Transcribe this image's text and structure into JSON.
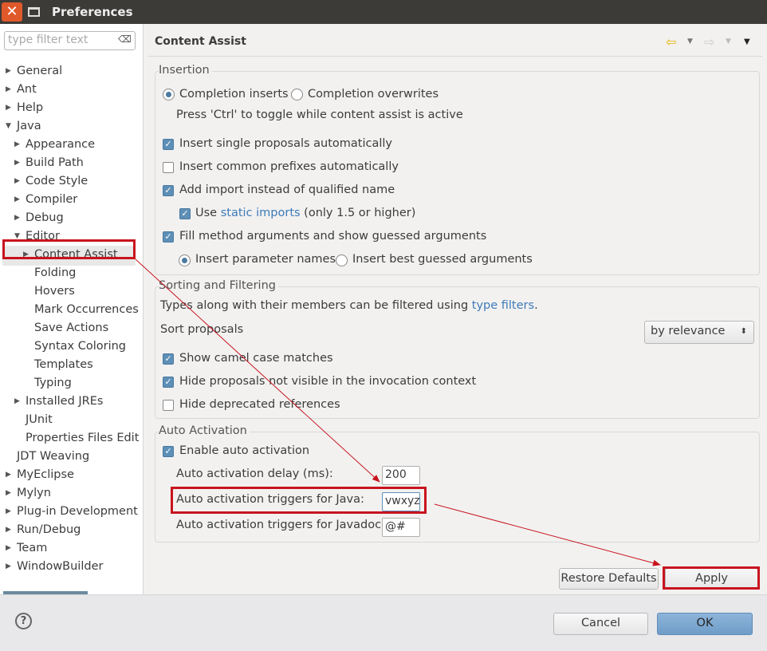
{
  "window": {
    "title": "Preferences",
    "close_icon": "close-icon",
    "maximize_icon": "maximize-icon"
  },
  "filter": {
    "placeholder": "type filter text"
  },
  "tree": [
    {
      "label": "General",
      "level": 0,
      "arrow": "right"
    },
    {
      "label": "Ant",
      "level": 0,
      "arrow": "right"
    },
    {
      "label": "Help",
      "level": 0,
      "arrow": "right"
    },
    {
      "label": "Java",
      "level": 0,
      "arrow": "down"
    },
    {
      "label": "Appearance",
      "level": 1,
      "arrow": "right"
    },
    {
      "label": "Build Path",
      "level": 1,
      "arrow": "right"
    },
    {
      "label": "Code Style",
      "level": 1,
      "arrow": "right"
    },
    {
      "label": "Compiler",
      "level": 1,
      "arrow": "right"
    },
    {
      "label": "Debug",
      "level": 1,
      "arrow": "right"
    },
    {
      "label": "Editor",
      "level": 1,
      "arrow": "down"
    },
    {
      "label": "Content Assist",
      "level": 2,
      "arrow": "right",
      "selected": true
    },
    {
      "label": "Folding",
      "level": 2
    },
    {
      "label": "Hovers",
      "level": 2
    },
    {
      "label": "Mark Occurrences",
      "level": 2
    },
    {
      "label": "Save Actions",
      "level": 2
    },
    {
      "label": "Syntax Coloring",
      "level": 2
    },
    {
      "label": "Templates",
      "level": 2
    },
    {
      "label": "Typing",
      "level": 2
    },
    {
      "label": "Installed JREs",
      "level": 1,
      "arrow": "right"
    },
    {
      "label": "JUnit",
      "level": 1
    },
    {
      "label": "Properties Files Edit",
      "level": 1
    },
    {
      "label": "JDT Weaving",
      "level": 0
    },
    {
      "label": "MyEclipse",
      "level": 0,
      "arrow": "right"
    },
    {
      "label": "Mylyn",
      "level": 0,
      "arrow": "right"
    },
    {
      "label": "Plug-in Development",
      "level": 0,
      "arrow": "right"
    },
    {
      "label": "Run/Debug",
      "level": 0,
      "arrow": "right"
    },
    {
      "label": "Team",
      "level": 0,
      "arrow": "right"
    },
    {
      "label": "WindowBuilder",
      "level": 0,
      "arrow": "right"
    }
  ],
  "page": {
    "title": "Content Assist"
  },
  "insertion": {
    "label": "Insertion",
    "completion_inserts": "Completion inserts",
    "completion_overwrites": "Completion overwrites",
    "hint": "Press 'Ctrl' to toggle while content assist is active",
    "single_proposals": "Insert single proposals automatically",
    "common_prefixes": "Insert common prefixes automatically",
    "add_import": "Add import instead of qualified name",
    "use": "Use",
    "static_imports": "static imports",
    "only15": "(only 1.5 or higher)",
    "fill_method": "Fill method arguments and show guessed arguments",
    "param_names": "Insert parameter names",
    "best_guessed": "Insert best guessed arguments"
  },
  "sorting": {
    "label": "Sorting and Filtering",
    "types_text": "Types along with their members can be filtered using",
    "type_filters": "type filters",
    "period": ".",
    "sort_proposals": "Sort proposals",
    "sort_value": "by relevance",
    "camel_case": "Show camel case matches",
    "hide_not_visible": "Hide proposals not visible in the invocation context",
    "hide_deprecated": "Hide deprecated references"
  },
  "auto": {
    "label": "Auto Activation",
    "enable": "Enable auto activation",
    "delay_label": "Auto activation delay (ms):",
    "delay_value": "200",
    "java_label": "Auto activation triggers for Java:",
    "java_value": "vwxyz",
    "javadoc_label": "Auto activation triggers for Javadoc:",
    "javadoc_value": "@#"
  },
  "buttons": {
    "restore": "Restore Defaults",
    "apply": "Apply",
    "cancel": "Cancel",
    "ok": "OK"
  },
  "colors": {
    "accent": "#5d8fb7",
    "annotation": "#c8141e",
    "ok_button": "#7ba7d0"
  }
}
